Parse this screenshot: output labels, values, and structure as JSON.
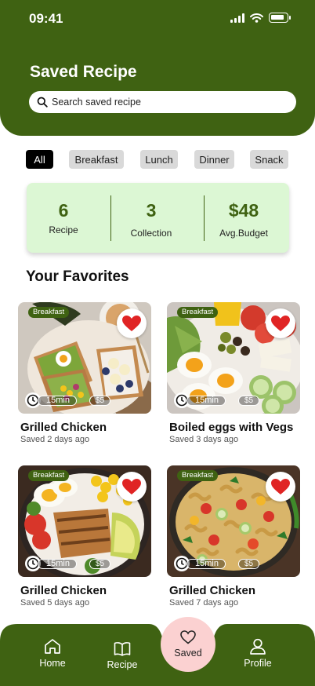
{
  "status_bar": {
    "time": "09:41"
  },
  "header": {
    "title": "Saved Recipe"
  },
  "search": {
    "placeholder": "Search saved recipe"
  },
  "categories": [
    "All",
    "Breakfast",
    "Lunch",
    "Dinner",
    "Snack"
  ],
  "active_category": "All",
  "stats": [
    {
      "value": "6",
      "label": "Recipe"
    },
    {
      "value": "3",
      "label": "Collection"
    },
    {
      "value": "$48",
      "label": "Avg.Budget"
    }
  ],
  "favorites": {
    "title": "Your Favorites",
    "recipes": [
      {
        "tag": "Breakfast",
        "time": "15min",
        "price": "$5",
        "title": "Grilled Chicken",
        "saved": "Saved 2 days ago"
      },
      {
        "tag": "Breakfast",
        "time": "15min",
        "price": "$5",
        "title": "Boiled eggs with Vegs",
        "saved": "Saved 3 days ago"
      },
      {
        "tag": "Breakfast",
        "time": "15min",
        "price": "$5",
        "title": "Grilled Chicken",
        "saved": "Saved 5 days ago"
      },
      {
        "tag": "Breakfast",
        "time": "15min",
        "price": "$5",
        "title": "Grilled Chicken",
        "saved": "Saved 7 days ago"
      }
    ]
  },
  "nav": {
    "home": "Home",
    "recipe": "Recipe",
    "saved": "Saved",
    "profile": "Profile"
  },
  "colors": {
    "brand_green": "#3f6212",
    "stats_bg": "#dcf7d4",
    "heart_red": "#e02424",
    "saved_pink": "#fbd1d1"
  }
}
